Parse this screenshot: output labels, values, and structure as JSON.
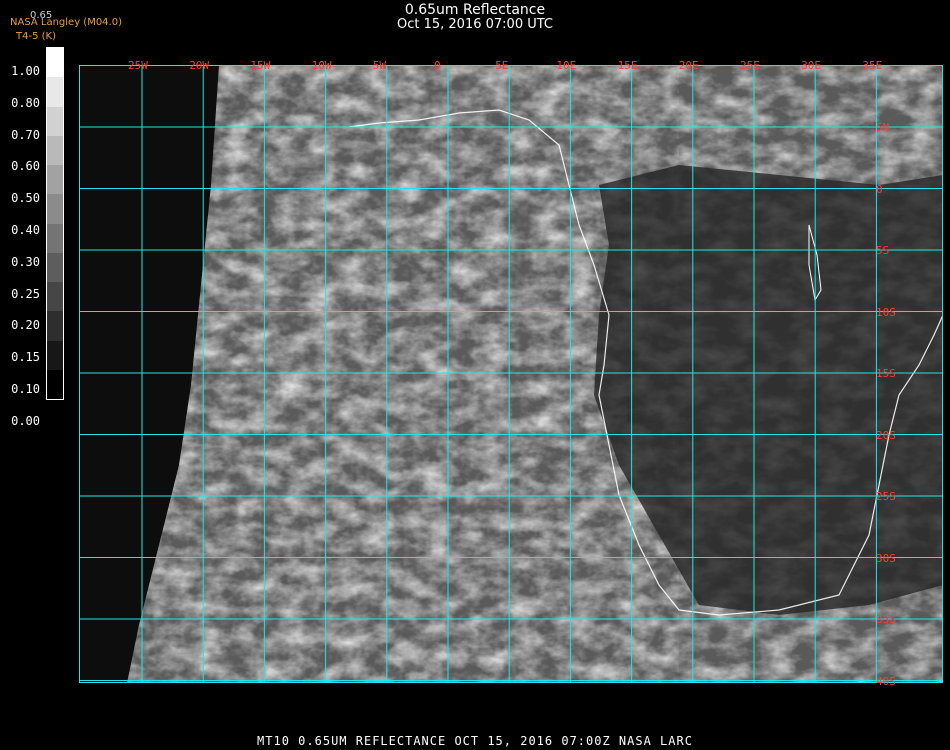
{
  "header": {
    "title": "0.65um Reflectance",
    "subtitle": "Oct 15, 2016 07:00 UTC",
    "credit": "NASA Langley (M04.0)",
    "credit_sub": "T4-5 (K)",
    "colorbar_top": "0.65"
  },
  "colorbar": {
    "labels": [
      "1.00",
      "0.80",
      "0.70",
      "0.60",
      "0.50",
      "0.40",
      "0.30",
      "0.25",
      "0.20",
      "0.15",
      "0.10",
      "0.00"
    ]
  },
  "grid": {
    "lon_labels": [
      "25W",
      "20W",
      "15W",
      "10W",
      "5W",
      "0",
      "5E",
      "10E",
      "15E",
      "20E",
      "25E",
      "30E",
      "35E"
    ],
    "lat_labels": [
      "5N",
      "0",
      "5S",
      "10S",
      "15S",
      "20S",
      "25S",
      "30S",
      "35S",
      "40S"
    ],
    "line_color": "#1ee6e6",
    "label_color": "#ff3b3b"
  },
  "footer": {
    "text": "MT10   0.65UM REFLECTANCE    OCT 15, 2016 07:00Z    NASA LARC"
  }
}
